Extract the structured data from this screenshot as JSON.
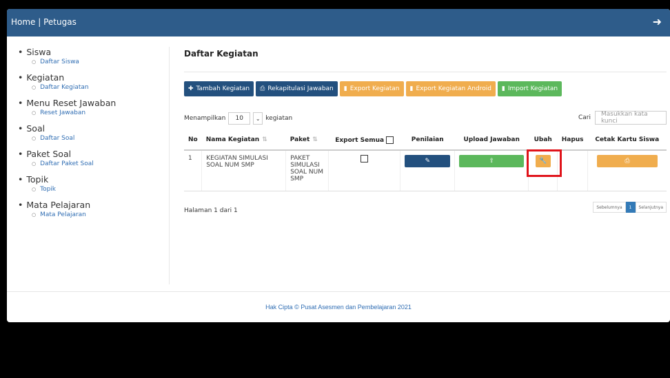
{
  "header": {
    "breadcrumb": "Home | Petugas",
    "logout_icon": "sign-out-icon"
  },
  "sidebar": {
    "groups": [
      {
        "title": "Siswa",
        "sub": "Daftar Siswa"
      },
      {
        "title": "Kegiatan",
        "sub": "Daftar Kegiatan"
      },
      {
        "title": "Menu Reset Jawaban",
        "sub": "Reset Jawaban"
      },
      {
        "title": "Soal",
        "sub": "Daftar Soal"
      },
      {
        "title": "Paket Soal",
        "sub": "Daftar Paket Soal"
      },
      {
        "title": "Topik",
        "sub": "Topik"
      },
      {
        "title": "Mata Pelajaran",
        "sub": "Mata Pelajaran"
      }
    ]
  },
  "main": {
    "title": "Daftar Kegiatan",
    "buttons": {
      "tambah": "Tambah Kegiatan",
      "rekap": "Rekapitulasi Jawaban",
      "export": "Export Kegiatan",
      "export_android": "Export Kegiatan Android",
      "import": "Import Kegiatan"
    },
    "length": {
      "prefix": "Menampilkan",
      "value": "10",
      "suffix": "kegiatan"
    },
    "search": {
      "label": "Cari",
      "placeholder": "Masukkan kata kunci"
    },
    "table": {
      "headers": {
        "no": "No",
        "nama": "Nama Kegiatan",
        "paket": "Paket",
        "export": "Export Semua",
        "penilaian": "Penilaian",
        "upload": "Upload Jawaban",
        "ubah": "Ubah",
        "hapus": "Hapus",
        "cetak": "Cetak Kartu Siswa"
      },
      "rows": [
        {
          "no": "1",
          "nama": "KEGIATAN SIMULASI SOAL NUM SMP",
          "paket": "PAKET SIMULASI SOAL NUM SMP"
        }
      ]
    },
    "info": "Halaman 1 dari 1",
    "pager": {
      "prev": "Sebelumnya",
      "current": "1",
      "next": "Selanjutnya"
    }
  },
  "footer": "Hak Cipta © Pusat Asesmen dan Pembelajaran 2021",
  "colors": {
    "topbar": "#2e5c8a",
    "blue_btn": "#23507e",
    "orange_btn": "#f0ad4e",
    "green_btn": "#5cb85c",
    "highlight": "#e0131a"
  }
}
